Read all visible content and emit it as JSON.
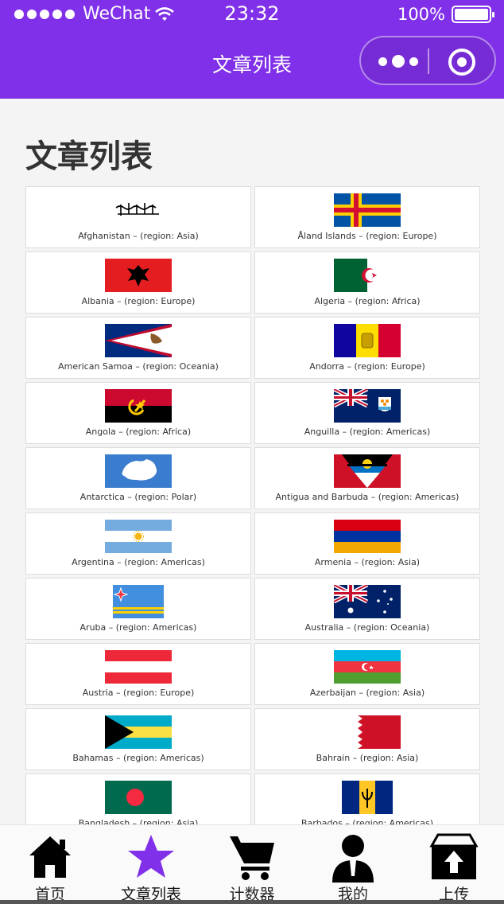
{
  "status_bar": {
    "carrier": "WeChat",
    "time": "23:32",
    "battery": "100%"
  },
  "nav": {
    "title": "文章列表"
  },
  "page": {
    "heading": "文章列表"
  },
  "countries": [
    {
      "flag": "afghanistan-flag",
      "caption": "Afghanistan – (region: Asia)"
    },
    {
      "flag": "aland-flag",
      "caption": "Åland Islands – (region: Europe)"
    },
    {
      "flag": "albania-flag",
      "caption": "Albania – (region: Europe)"
    },
    {
      "flag": "algeria-flag",
      "caption": "Algeria – (region: Africa)"
    },
    {
      "flag": "american-samoa-flag",
      "caption": "American Samoa – (region: Oceania)"
    },
    {
      "flag": "andorra-flag",
      "caption": "Andorra – (region: Europe)"
    },
    {
      "flag": "angola-flag",
      "caption": "Angola – (region: Africa)"
    },
    {
      "flag": "anguilla-flag",
      "caption": "Anguilla – (region: Americas)"
    },
    {
      "flag": "antarctica-flag",
      "caption": "Antarctica – (region: Polar)"
    },
    {
      "flag": "antigua-barbuda-flag",
      "caption": "Antigua and Barbuda – (region: Americas)"
    },
    {
      "flag": "argentina-flag",
      "caption": "Argentina – (region: Americas)"
    },
    {
      "flag": "armenia-flag",
      "caption": "Armenia – (region: Asia)"
    },
    {
      "flag": "aruba-flag",
      "caption": "Aruba – (region: Americas)"
    },
    {
      "flag": "australia-flag",
      "caption": "Australia – (region: Oceania)"
    },
    {
      "flag": "austria-flag",
      "caption": "Austria – (region: Europe)"
    },
    {
      "flag": "azerbaijan-flag",
      "caption": "Azerbaijan – (region: Asia)"
    },
    {
      "flag": "bahamas-flag",
      "caption": "Bahamas – (region: Americas)"
    },
    {
      "flag": "bahrain-flag",
      "caption": "Bahrain – (region: Asia)"
    },
    {
      "flag": "bangladesh-flag",
      "caption": "Bangladesh – (region: Asia)"
    },
    {
      "flag": "barbados-flag",
      "caption": "Barbados – (region: Americas)"
    }
  ],
  "tabs": [
    {
      "label": "首页",
      "icon": "home-icon",
      "active": false
    },
    {
      "label": "文章列表",
      "icon": "star-icon",
      "active": true,
      "color": "#8030e8"
    },
    {
      "label": "计数器",
      "icon": "cart-icon",
      "active": false
    },
    {
      "label": "我的",
      "icon": "user-icon",
      "active": false
    },
    {
      "label": "上传",
      "icon": "upload-icon",
      "active": false
    }
  ]
}
